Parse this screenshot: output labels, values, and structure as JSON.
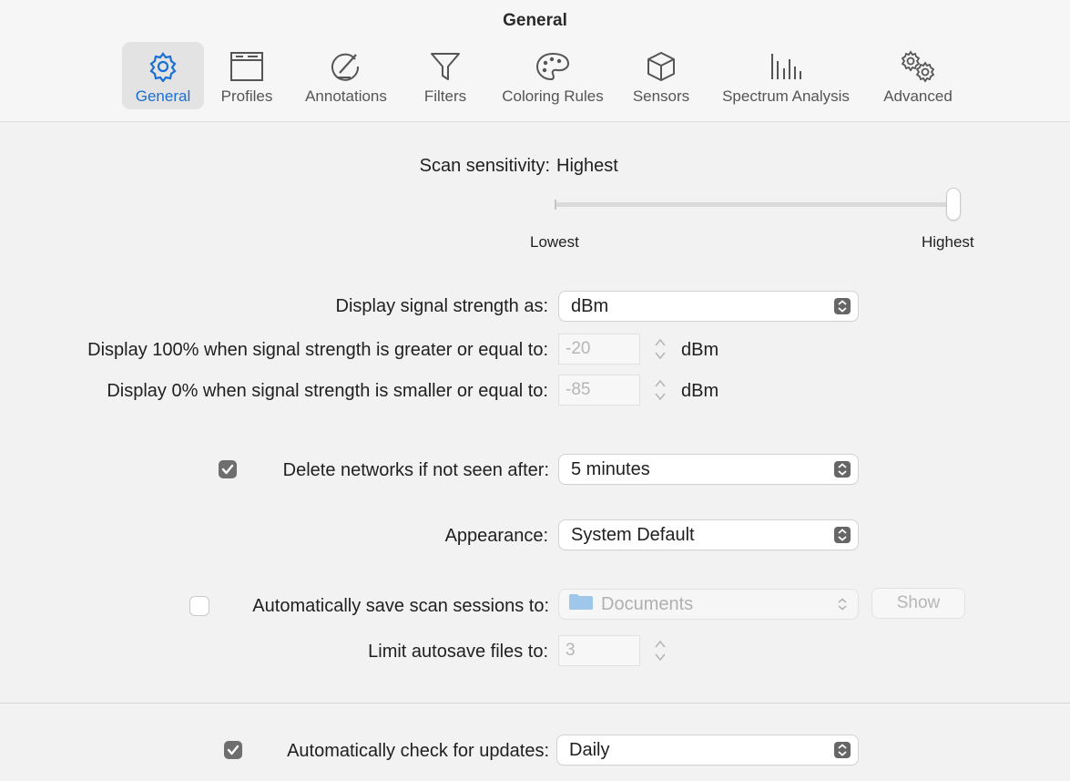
{
  "window": {
    "title": "General"
  },
  "tabs": [
    {
      "label": "General",
      "icon": "gear-icon",
      "active": true
    },
    {
      "label": "Profiles",
      "icon": "window-icon",
      "active": false
    },
    {
      "label": "Annotations",
      "icon": "pencil-circle-icon",
      "active": false
    },
    {
      "label": "Filters",
      "icon": "funnel-icon",
      "active": false
    },
    {
      "label": "Coloring Rules",
      "icon": "palette-icon",
      "active": false
    },
    {
      "label": "Sensors",
      "icon": "cube-icon",
      "active": false
    },
    {
      "label": "Spectrum Analysis",
      "icon": "spectrum-bars-icon",
      "active": false
    },
    {
      "label": "Advanced",
      "icon": "gears-icon",
      "active": false
    }
  ],
  "accent_color": "#1a6fd4",
  "sensitivity": {
    "label": "Scan sensitivity:",
    "value": "Highest",
    "min_label": "Lowest",
    "max_label": "Highest",
    "level_fraction": 1.0
  },
  "signal_display": {
    "label": "Display signal strength as:",
    "value": "dBm"
  },
  "max_threshold": {
    "label": "Display 100% when signal strength is greater or equal to:",
    "value": "-20",
    "unit": "dBm"
  },
  "min_threshold": {
    "label": "Display 0% when signal strength is smaller or equal to:",
    "value": "-85",
    "unit": "dBm"
  },
  "delete_networks": {
    "checked": true,
    "label": "Delete networks if not seen after:",
    "value": "5 minutes"
  },
  "appearance": {
    "label": "Appearance:",
    "value": "System Default"
  },
  "autosave": {
    "checked": false,
    "label": "Automatically save scan sessions to:",
    "folder_icon": "folder-icon",
    "folder": "Documents",
    "show_button": "Show"
  },
  "autosave_limit": {
    "label": "Limit autosave files to:",
    "value": "3"
  },
  "updates": {
    "checked": true,
    "label": "Automatically check for updates:",
    "value": "Daily"
  }
}
